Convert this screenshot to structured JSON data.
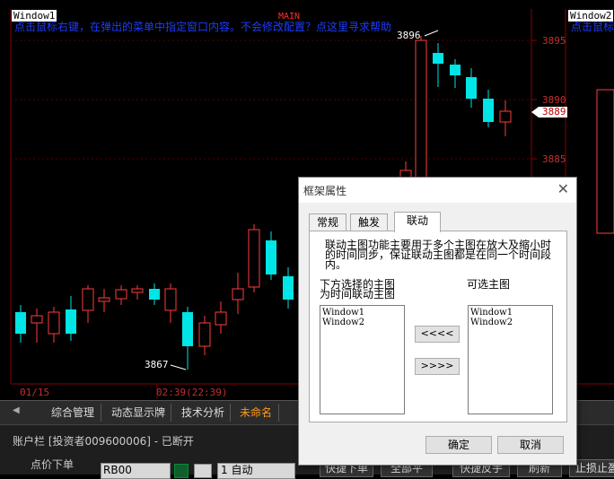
{
  "chart": {
    "window1_label": "Window1",
    "window2_label": "Window2",
    "hint_text": "点击鼠标右键，在弹出的菜单中指定窗口内容。不会修改配置？点这里寻求帮助",
    "hint_text_right": "点击鼠标右",
    "main_tag": "MAIN",
    "price_labels": [
      "3895",
      "3890",
      "3885"
    ],
    "current_price": "3889",
    "high_anno": "3896",
    "low_anno": "3867",
    "time_left": "01/15",
    "time_mid": "02:39(22:39)",
    "colors": {
      "up": "#ff3b3b",
      "down": "#00e5e5",
      "grid": "#8b0000"
    }
  },
  "tabs": {
    "items": [
      {
        "label": "综合管理"
      },
      {
        "label": "动态显示牌"
      },
      {
        "label": "技术分析"
      },
      {
        "label": "未命名"
      }
    ],
    "active_index": 3
  },
  "account": {
    "title": "账户栏 [投资者009600006] - 已断开",
    "order_label": "点价下单",
    "contract_value": "RB00",
    "qty_value": "1 自动",
    "buttons": [
      "快捷下单",
      "全部平",
      "快捷反手",
      "刷新",
      "止损止盈"
    ]
  },
  "dialog": {
    "title": "框架属性",
    "tabs": [
      "常规",
      "触发",
      "联动"
    ],
    "active_tab": 2,
    "description": [
      "联动主图功能主要用于多个主图在放大及缩小时",
      "的时间同步，保证联动主图都是在同一个时间段",
      "内。"
    ],
    "left_heading": [
      "下方选择的主图",
      "为时间联动主图"
    ],
    "right_heading": "可选主图",
    "left_list": [
      "Window1",
      "Window2"
    ],
    "right_list": [
      "Window1",
      "Window2"
    ],
    "move_left_label": "<<<<",
    "move_right_label": ">>>>",
    "ok_label": "确定",
    "cancel_label": "取消"
  }
}
